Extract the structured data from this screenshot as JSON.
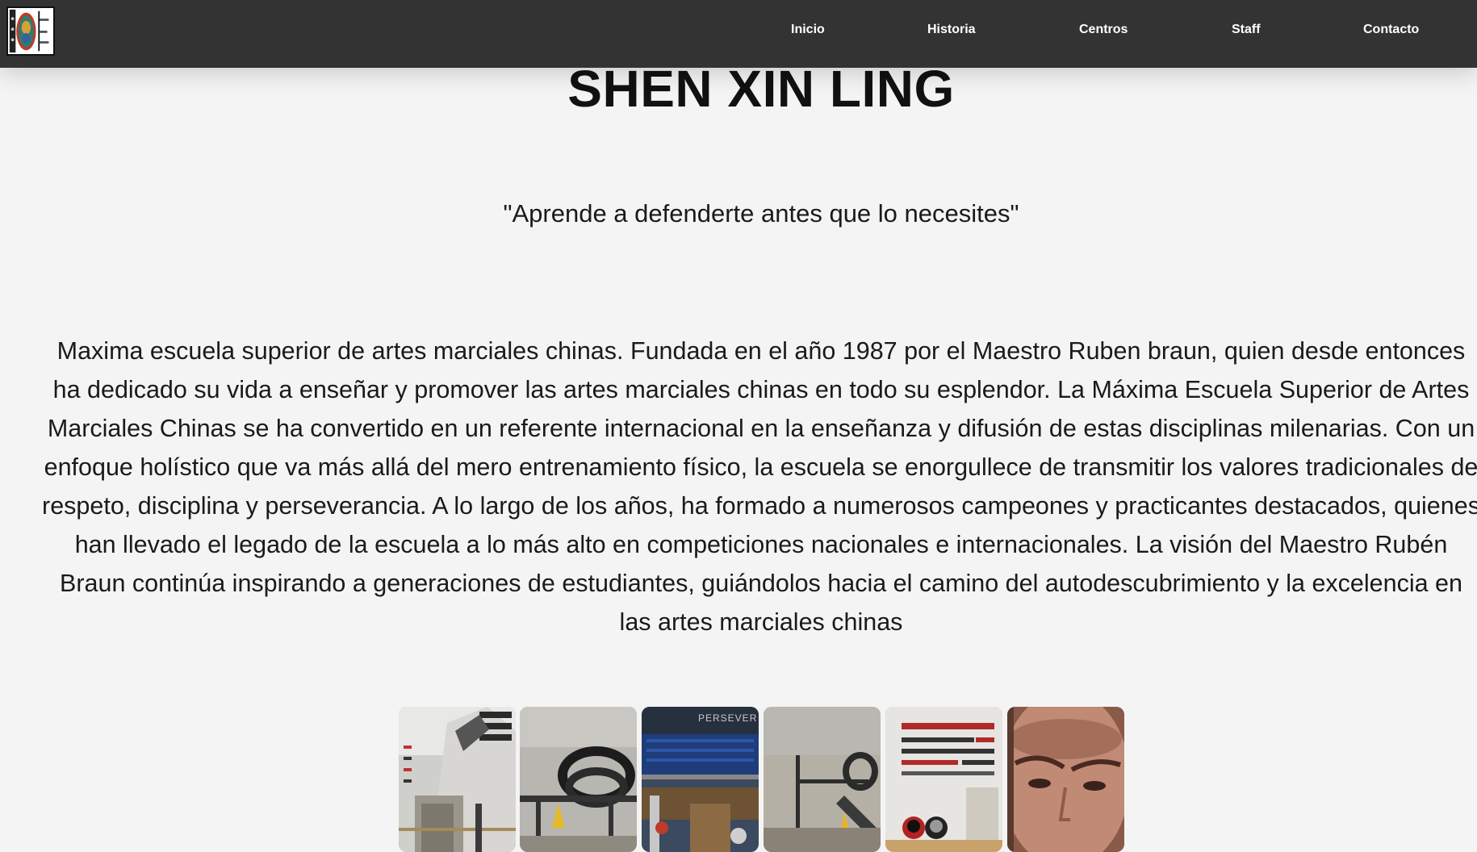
{
  "nav": {
    "logo_label": "Shen Xin Ling",
    "items": [
      {
        "label": "Inicio"
      },
      {
        "label": "Historia"
      },
      {
        "label": "Centros"
      },
      {
        "label": "Staff"
      },
      {
        "label": "Contacto"
      }
    ]
  },
  "hero": {
    "title": "SHEN XIN LING",
    "motto": "\"Aprende a defenderte antes que lo necesites\"",
    "description": "Maxima escuela superior de artes marciales chinas. Fundada en el año 1987 por el Maestro Ruben braun, quien desde entonces ha dedicado su vida a enseñar y promover las artes marciales chinas en todo su esplendor. La Máxima Escuela Superior de Artes Marciales Chinas se ha convertido en un referente internacional en la enseñanza y difusión de estas disciplinas milenarias. Con un enfoque holístico que va más allá del mero entrenamiento físico, la escuela se enorgullece de transmitir los valores tradicionales de respeto, disciplina y perseverancia. A lo largo de los años, ha formado a numerosos campeones y practicantes destacados, quienes han llevado el legado de la escuela a lo más alto en competiciones nacionales e internacionales. La visión del Maestro Rubén Braun continúa inspirando a generaciones de estudiantes, guiándolos hacia el camino del autodescubrimiento y la excelencia en las artes marciales chinas"
  },
  "gallery": {
    "photos": [
      {
        "icon": "dojo-wall-photo"
      },
      {
        "icon": "training-equipment-photo"
      },
      {
        "icon": "gym-banner-photo"
      },
      {
        "icon": "equipment-rack-photo"
      },
      {
        "icon": "belts-helmets-photo"
      },
      {
        "icon": "face-portrait-photo"
      }
    ],
    "banner_text": "PERSEVER"
  },
  "colors": {
    "navbar_bg": "#333333",
    "nav_text": "#ffffff",
    "page_bg": "#f4f4f4",
    "text": "#111111"
  }
}
